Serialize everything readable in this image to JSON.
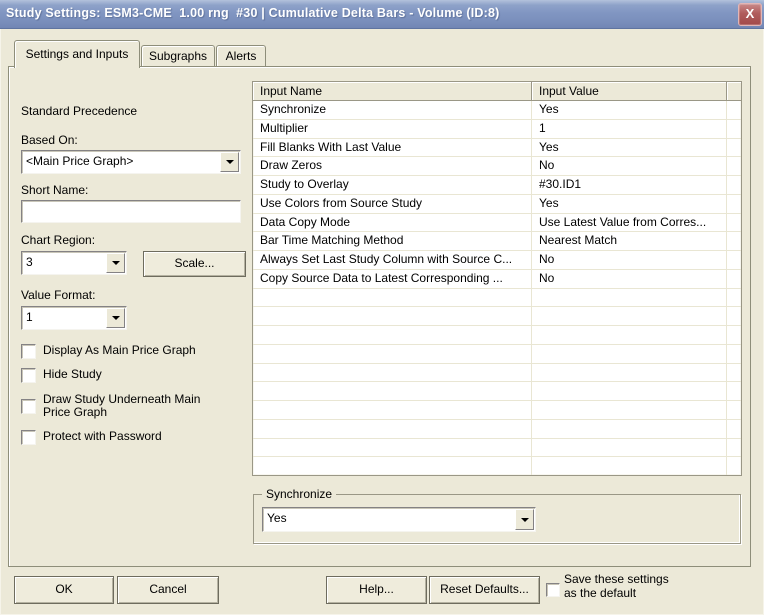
{
  "window": {
    "title": "Study Settings: ESM3-CME  1.00 rng  #30 | Cumulative Delta Bars - Volume (ID:8)",
    "close_glyph": "X"
  },
  "tabs": [
    {
      "label": "Settings and Inputs",
      "active": true
    },
    {
      "label": "Subgraphs",
      "active": false
    },
    {
      "label": "Alerts",
      "active": false
    }
  ],
  "left_panel": {
    "standard_precedence_label": "Standard Precedence",
    "based_on_label": "Based On:",
    "based_on_value": "<Main Price Graph>",
    "short_name_label": "Short Name:",
    "short_name_value": "",
    "chart_region_label": "Chart Region:",
    "chart_region_value": "3",
    "scale_button_label": "Scale...",
    "value_format_label": "Value Format:",
    "value_format_value": "1",
    "checkboxes": [
      {
        "label": "Display As Main Price Graph",
        "checked": false
      },
      {
        "label": "Hide Study",
        "checked": false
      },
      {
        "label": "Draw Study Underneath Main Price Graph",
        "checked": false
      },
      {
        "label": "Protect with Password",
        "checked": false
      }
    ]
  },
  "inputs_table": {
    "columns": [
      "Input Name",
      "Input Value"
    ],
    "rows": [
      [
        "Synchronize",
        "Yes"
      ],
      [
        "Multiplier",
        "1"
      ],
      [
        "Fill Blanks With Last Value",
        "Yes"
      ],
      [
        "Draw Zeros",
        "No"
      ],
      [
        "Study to Overlay",
        "#30.ID1"
      ],
      [
        "Use Colors from Source Study",
        "Yes"
      ],
      [
        "Data Copy Mode",
        "Use Latest Value from Corres..."
      ],
      [
        "Bar Time Matching Method",
        "Nearest Match"
      ],
      [
        "Always Set Last Study Column with Source C...",
        "No"
      ],
      [
        "Copy Source Data to Latest Corresponding ...",
        "No"
      ]
    ],
    "empty_row_count": 11
  },
  "sync_group": {
    "label": "Synchronize",
    "value": "Yes"
  },
  "footer": {
    "ok_label": "OK",
    "cancel_label": "Cancel",
    "help_label": "Help...",
    "reset_defaults_label": "Reset Defaults...",
    "save_settings_line1": "Save these settings",
    "save_settings_line2": "as the default",
    "save_settings_checked": false
  },
  "colors": {
    "dialog_bg": "#ece9d8",
    "titlebar_top": "#b3c2dc",
    "titlebar_bottom": "#7186b4",
    "title_text": "#ffffff",
    "close_button": "#a94e4e",
    "table_bg": "#ffffff",
    "table_grid": "#e9e6d3",
    "border_dark": "#848284",
    "text": "#000000"
  }
}
